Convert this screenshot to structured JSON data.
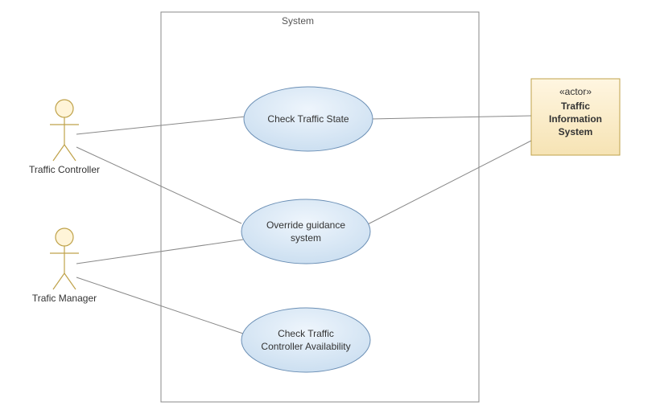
{
  "diagram": {
    "title": "System",
    "actors": {
      "controller": {
        "label": "Traffic Controller"
      },
      "manager": {
        "label": "Trafic Manager"
      },
      "external": {
        "stereotype": "«actor»",
        "line1": "Traffic",
        "line2": "Information",
        "line3": "System"
      }
    },
    "usecases": {
      "uc1": {
        "line1": "Check Traffic State"
      },
      "uc2": {
        "line1": "Override guidance",
        "line2": "system"
      },
      "uc3": {
        "line1": "Check Traffic",
        "line2": "Controller Availability"
      }
    }
  },
  "chart_data": {
    "type": "uml-use-case",
    "system_boundary": "System",
    "actors": [
      {
        "id": "traffic-controller",
        "name": "Traffic Controller",
        "kind": "human"
      },
      {
        "id": "traffic-manager",
        "name": "Trafic Manager",
        "kind": "human"
      },
      {
        "id": "traffic-info-system",
        "name": "Traffic Information System",
        "kind": "external-system",
        "stereotype": "actor"
      }
    ],
    "use_cases": [
      {
        "id": "check-traffic-state",
        "name": "Check Traffic State"
      },
      {
        "id": "override-guidance",
        "name": "Override guidance system"
      },
      {
        "id": "check-controller-availability",
        "name": "Check Traffic Controller Availability"
      }
    ],
    "associations": [
      {
        "actor": "traffic-controller",
        "use_case": "check-traffic-state"
      },
      {
        "actor": "traffic-controller",
        "use_case": "override-guidance"
      },
      {
        "actor": "traffic-manager",
        "use_case": "override-guidance"
      },
      {
        "actor": "traffic-manager",
        "use_case": "check-controller-availability"
      },
      {
        "actor": "traffic-info-system",
        "use_case": "check-traffic-state"
      },
      {
        "actor": "traffic-info-system",
        "use_case": "override-guidance"
      }
    ]
  }
}
